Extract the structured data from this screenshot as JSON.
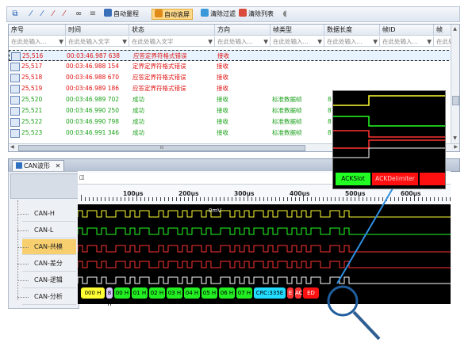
{
  "toolbar": {
    "auto_scale_label": "自动量程",
    "auto_scroll_label": "自动滚屏",
    "clear_filter_label": "清除过滤",
    "clear_list_label": "清除列表"
  },
  "table": {
    "columns": [
      "序号",
      "时间",
      "状态",
      "方向",
      "帧类型",
      "数据长度",
      "帧ID",
      "帧"
    ],
    "filter_placeholder": "在此处输入...",
    "filter_placeholder_long": "在此处输入文字",
    "rows": [
      {
        "seq": "25,516",
        "time": "00:03:46.987 638",
        "status": "应答定界符格式错误",
        "dir": "接收",
        "type": "",
        "len": ""
      },
      {
        "seq": "25,517",
        "time": "00:03:46.988 154",
        "status": "定界定界符格式错误",
        "dir": "接收",
        "type": "",
        "len": ""
      },
      {
        "seq": "25,518",
        "time": "00:03:46.988 670",
        "status": "应答定界符格式错误",
        "dir": "接收",
        "type": "",
        "len": ""
      },
      {
        "seq": "25,519",
        "time": "00:03:46.989 186",
        "status": "应答定界符格式错误",
        "dir": "接收",
        "type": "",
        "len": ""
      },
      {
        "seq": "25,520",
        "time": "00:03:46.989 702",
        "status": "成功",
        "dir": "接收",
        "type": "标准数据帧",
        "len": "8"
      },
      {
        "seq": "25,521",
        "time": "00:03:46.990 250",
        "status": "成功",
        "dir": "接收",
        "type": "标准数据帧",
        "len": "8"
      },
      {
        "seq": "25,522",
        "time": "00:03:46.990 798",
        "status": "成功",
        "dir": "接收",
        "type": "标准数据帧",
        "len": "8"
      },
      {
        "seq": "25,523",
        "time": "00:03:46.991 346",
        "status": "成功",
        "dir": "接收",
        "type": "标准数据帧",
        "len": "8"
      }
    ],
    "hscroll_glyph": "III"
  },
  "can_panel": {
    "tab_label": "CAN波形",
    "sidebar": [
      "CAN-H",
      "CAN-L",
      "CAN-共模",
      "CAN-差分",
      "CAN-逻辑",
      "CAN-分析"
    ],
    "ruler_labels": [
      "100us",
      "200us",
      "300us",
      "400us",
      "500us",
      "600us"
    ],
    "wave_label": "0mV",
    "segments": [
      "000 H",
      "8 H",
      "00 H",
      "01 H",
      "02 H",
      "03 H",
      "04 H",
      "05 H",
      "06 H",
      "07 H",
      "CRC:335E",
      "E",
      "ACK",
      "ED"
    ],
    "zoom_labels": [
      "ACKSlot",
      "ACKDelimiter",
      ""
    ]
  },
  "colors": {
    "error_red": "#e01010",
    "success_green": "#19a019",
    "accent_blue": "#2f8fe0"
  }
}
